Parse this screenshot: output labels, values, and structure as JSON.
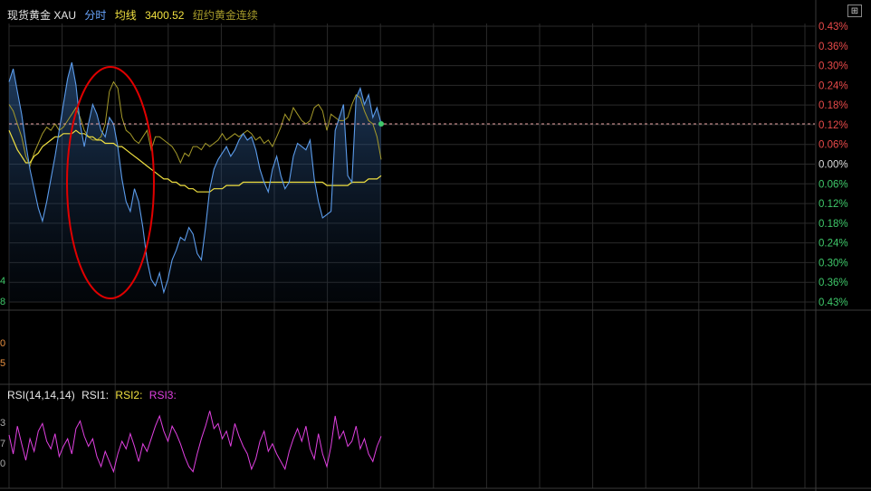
{
  "header": {
    "title": "现货黄金 XAU",
    "mode": "分时",
    "avg_label": "均线",
    "avg_value": "3400.52",
    "compare_label": "纽约黄金连续"
  },
  "rsi_header": {
    "name": "RSI(14,14,14)",
    "rsi1": "RSI1:",
    "rsi2": "RSI2:",
    "rsi3": "RSI3:"
  },
  "expand_icon": "expand-icon",
  "left_fragments": {
    "main": [
      "4",
      "8"
    ],
    "volume": [
      "0",
      "5"
    ],
    "rsi": [
      "3",
      "7",
      "0"
    ]
  },
  "colors": {
    "price": "#5b9bea",
    "average": "#f0e040",
    "compare": "#a59a2a",
    "rsi": "#e040e0",
    "up": "#e84a4a",
    "down": "#3fc86a",
    "grid": "#2a2a2a",
    "annotation": "#e00000"
  },
  "chart_data": {
    "type": "line",
    "y_axis_percent_labels": [
      "0.43%",
      "0.36%",
      "0.30%",
      "0.24%",
      "0.18%",
      "0.12%",
      "0.06%",
      "0.00%",
      "0.06%",
      "0.12%",
      "0.18%",
      "0.24%",
      "0.30%",
      "0.36%",
      "0.43%"
    ],
    "ylim_percent": [
      -0.43,
      0.43
    ],
    "current_change_percent": 0.12,
    "grid": true,
    "series": [
      {
        "name": "现货黄金 XAU",
        "values": [
          0.25,
          0.29,
          0.22,
          0.15,
          0.06,
          -0.02,
          -0.08,
          -0.14,
          -0.18,
          -0.12,
          -0.05,
          0.02,
          0.1,
          0.18,
          0.26,
          0.31,
          0.24,
          0.12,
          0.05,
          0.12,
          0.18,
          0.15,
          0.1,
          0.08,
          0.14,
          0.12,
          0.05,
          -0.05,
          -0.12,
          -0.15,
          -0.08,
          -0.12,
          -0.2,
          -0.3,
          -0.36,
          -0.38,
          -0.34,
          -0.4,
          -0.36,
          -0.3,
          -0.27,
          -0.23,
          -0.24,
          -0.2,
          -0.22,
          -0.28,
          -0.3,
          -0.2,
          -0.08,
          -0.02,
          0.01,
          0.03,
          0.05,
          0.02,
          0.04,
          0.07,
          0.09,
          0.07,
          0.08,
          0.04,
          -0.02,
          -0.06,
          -0.09,
          -0.02,
          0.02,
          -0.04,
          -0.08,
          -0.06,
          0.02,
          0.06,
          0.05,
          0.04,
          0.07,
          -0.05,
          -0.12,
          -0.17,
          -0.16,
          -0.15,
          0.1,
          0.14,
          0.18,
          -0.04,
          -0.06,
          0.2,
          0.23,
          0.18,
          0.21,
          0.14,
          0.17,
          0.12
        ]
      },
      {
        "name": "纽约黄金连续",
        "values": [
          0.18,
          0.16,
          0.12,
          0.08,
          0.02,
          -0.01,
          0.03,
          0.06,
          0.09,
          0.11,
          0.1,
          0.12,
          0.1,
          0.11,
          0.13,
          0.15,
          0.17,
          0.14,
          0.1,
          0.08,
          0.07,
          0.07,
          0.08,
          0.12,
          0.22,
          0.25,
          0.23,
          0.14,
          0.1,
          0.09,
          0.07,
          0.06,
          0.08,
          0.1,
          0.04,
          0.08,
          0.08,
          0.07,
          0.06,
          0.05,
          0.03,
          0.0,
          0.03,
          0.02,
          0.05,
          0.05,
          0.04,
          0.06,
          0.05,
          0.06,
          0.07,
          0.09,
          0.07,
          0.08,
          0.09,
          0.08,
          0.09,
          0.1,
          0.09,
          0.07,
          0.08,
          0.06,
          0.07,
          0.05,
          0.08,
          0.11,
          0.15,
          0.13,
          0.17,
          0.15,
          0.13,
          0.12,
          0.13,
          0.17,
          0.18,
          0.16,
          0.1,
          0.15,
          0.14,
          0.13,
          0.13,
          0.14,
          0.18,
          0.21,
          0.2,
          0.16,
          0.13,
          0.12,
          0.08,
          0.01
        ]
      },
      {
        "name": "均线",
        "values": [
          0.1,
          0.07,
          0.04,
          0.02,
          0.0,
          0.0,
          0.02,
          0.03,
          0.05,
          0.06,
          0.07,
          0.08,
          0.08,
          0.09,
          0.09,
          0.09,
          0.1,
          0.09,
          0.09,
          0.08,
          0.08,
          0.07,
          0.07,
          0.06,
          0.06,
          0.06,
          0.05,
          0.05,
          0.04,
          0.03,
          0.02,
          0.01,
          0.0,
          -0.01,
          -0.02,
          -0.03,
          -0.04,
          -0.05,
          -0.05,
          -0.06,
          -0.06,
          -0.07,
          -0.07,
          -0.08,
          -0.08,
          -0.09,
          -0.09,
          -0.09,
          -0.09,
          -0.08,
          -0.08,
          -0.08,
          -0.07,
          -0.07,
          -0.07,
          -0.07,
          -0.06,
          -0.06,
          -0.06,
          -0.06,
          -0.06,
          -0.06,
          -0.06,
          -0.06,
          -0.06,
          -0.06,
          -0.06,
          -0.06,
          -0.06,
          -0.06,
          -0.06,
          -0.06,
          -0.06,
          -0.06,
          -0.06,
          -0.06,
          -0.07,
          -0.07,
          -0.07,
          -0.07,
          -0.07,
          -0.07,
          -0.06,
          -0.06,
          -0.06,
          -0.06,
          -0.05,
          -0.05,
          -0.05,
          -0.04
        ]
      },
      {
        "name": "RSI",
        "values": [
          55,
          40,
          62,
          48,
          35,
          52,
          42,
          58,
          64,
          50,
          44,
          56,
          38,
          46,
          52,
          40,
          60,
          66,
          54,
          46,
          52,
          38,
          30,
          42,
          34,
          26,
          40,
          50,
          44,
          56,
          46,
          34,
          48,
          42,
          52,
          62,
          70,
          58,
          50,
          62,
          56,
          48,
          38,
          30,
          26,
          40,
          52,
          62,
          74,
          60,
          64,
          52,
          58,
          46,
          64,
          54,
          46,
          40,
          28,
          36,
          50,
          58,
          42,
          48,
          40,
          34,
          28,
          42,
          52,
          60,
          50,
          62,
          44,
          36,
          56,
          40,
          30,
          46,
          70,
          52,
          58,
          46,
          50,
          62,
          44,
          52,
          40,
          34,
          46,
          54
        ]
      }
    ]
  }
}
